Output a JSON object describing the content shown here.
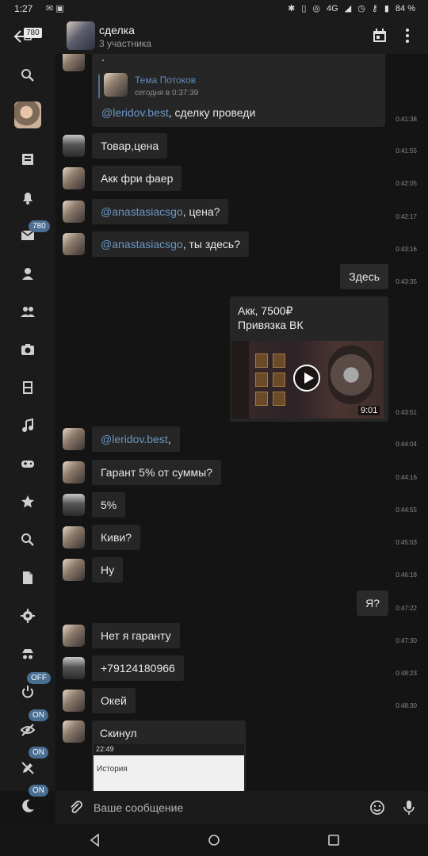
{
  "status_bar": {
    "time": "1:27",
    "network": "4G",
    "battery": "84 %"
  },
  "header": {
    "back_badge": "780",
    "title": "сделка",
    "subtitle": "3 участника"
  },
  "rail": {
    "mail_badge": "780",
    "toggles": [
      "OFF",
      "ON",
      "ON",
      "ON"
    ]
  },
  "messages": [
    {
      "type": "quote",
      "text_top": ".",
      "quoted_name": "Тема Потоков",
      "quoted_time": "сегодня в 0:37:39",
      "mention": "@leridov.best",
      "text": ", сделку проведи",
      "time": "0:41:38"
    },
    {
      "author": "b",
      "text": "Товар,цена",
      "time": "0:41:55"
    },
    {
      "author": "a",
      "text": "Акк фри фаер",
      "time": "0:42:05"
    },
    {
      "author": "a",
      "mention": "@anastasiacsgo",
      "text": ", цена?",
      "time": "0:42:17"
    },
    {
      "author": "a",
      "mention": "@anastasiacsgo",
      "text": ", ты здесь?",
      "time": "0:43:16"
    },
    {
      "author": "out",
      "text": "Здесь",
      "time": "0:43:35"
    },
    {
      "type": "media",
      "line1": "Акк, 7500₽",
      "line2": "Привязка ВК",
      "duration": "9:01",
      "time": "0:43:51"
    },
    {
      "author": "a",
      "mention": "@leridov.best",
      "text": ",",
      "time": "0:44:04"
    },
    {
      "author": "a",
      "text": "Гарант 5% от суммы?",
      "time": "0:44:16"
    },
    {
      "author": "b",
      "text": "5%",
      "time": "0:44:55"
    },
    {
      "author": "a",
      "text": "Киви?",
      "time": "0:45:03"
    },
    {
      "author": "a",
      "text": "Ну",
      "time": "0:46:18"
    },
    {
      "author": "out",
      "text": "Я?",
      "time": "0:47:22"
    },
    {
      "author": "a",
      "text": "Нет я гаранту",
      "time": "0:47:30"
    },
    {
      "author": "b",
      "text": "+79124180966",
      "time": "0:48:23"
    },
    {
      "author": "a",
      "text": "Окей",
      "time": "0:48:30"
    },
    {
      "type": "screenshot",
      "caption": "Скинул",
      "shot_time": "22:49",
      "shot_header": "История"
    }
  ],
  "input": {
    "placeholder": "Ваше сообщение"
  }
}
